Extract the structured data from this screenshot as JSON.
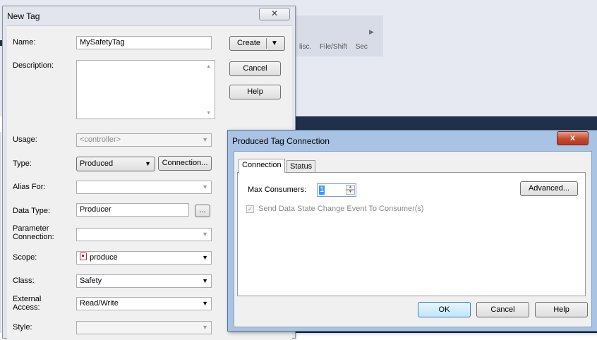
{
  "background": {
    "tabs": [
      "lisc.",
      "File/Shift",
      "Sec"
    ]
  },
  "new_tag_dialog": {
    "title": "New Tag",
    "close_glyph": "✕",
    "labels": {
      "name": "Name:",
      "description": "Description:",
      "usage": "Usage:",
      "type": "Type:",
      "alias_for": "Alias For:",
      "data_type": "Data Type:",
      "parameter_connection_1": "Parameter",
      "parameter_connection_2": "Connection:",
      "scope": "Scope:",
      "class": "Class:",
      "external_access_1": "External",
      "external_access_2": "Access:",
      "style": "Style:"
    },
    "values": {
      "name": "MySafetyTag",
      "description": "",
      "usage": "<controller>",
      "type": "Produced",
      "alias_for": "",
      "data_type": "Producer",
      "parameter_connection": "",
      "scope": "produce",
      "class": "Safety",
      "external_access": "Read/Write",
      "style": ""
    },
    "buttons": {
      "create": "Create",
      "cancel": "Cancel",
      "help": "Help",
      "connection": "Connection...",
      "browse": "..."
    }
  },
  "produced_tag_dialog": {
    "title": "Produced Tag Connection",
    "close_glyph": "x",
    "tabs": [
      "Connection",
      "Status"
    ],
    "max_consumers_label": "Max Consumers:",
    "max_consumers_value": "1",
    "advanced_button": "Advanced...",
    "send_data_state_label": "Send Data State Change Event To Consumer(s)",
    "send_data_state_checked": true,
    "buttons": {
      "ok": "OK",
      "cancel": "Cancel",
      "help": "Help"
    }
  }
}
